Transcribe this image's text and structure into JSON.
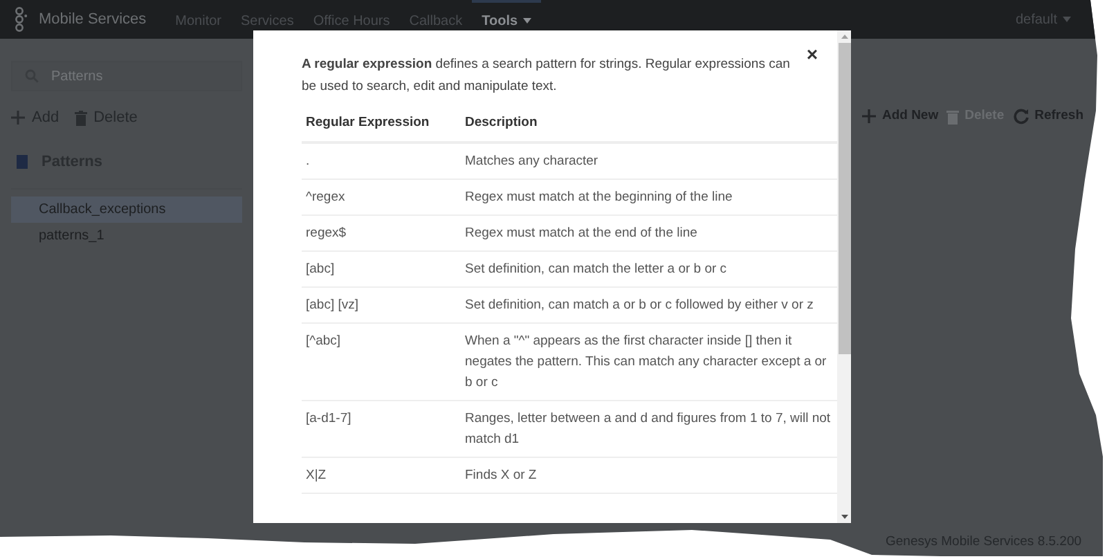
{
  "app": {
    "title": "Mobile Services",
    "menu": [
      {
        "label": "Monitor",
        "selected": false
      },
      {
        "label": "Services",
        "selected": false
      },
      {
        "label": "Office Hours",
        "selected": false
      },
      {
        "label": "Callback",
        "selected": false
      },
      {
        "label": "Tools",
        "selected": true,
        "dropdown": true
      }
    ],
    "user_menu": "default"
  },
  "sidebar": {
    "search": {
      "placeholder": "Patterns"
    },
    "actions": [
      "Add",
      "Delete"
    ],
    "section": "Patterns",
    "items": [
      {
        "label": "Callback_exceptions",
        "selected": true
      },
      {
        "label": "patterns_1",
        "selected": false
      }
    ]
  },
  "toolbar": [
    {
      "kind": "add",
      "label": "Add New",
      "disabled": false
    },
    {
      "kind": "delete",
      "label": "Delete",
      "disabled": true
    },
    {
      "kind": "refresh",
      "label": "Refresh",
      "disabled": false
    }
  ],
  "footer": "Genesys Mobile Services 8.5.200",
  "dialog": {
    "close": "×",
    "intro": "**A regular expression** defines a search pattern for strings. Regular expressions can be used to search, edit and manipulate text.",
    "columns": [
      "Regular Expression",
      "Description"
    ],
    "rows": [
      {
        "expression": ".",
        "description": "Matches any character"
      },
      {
        "expression": "^regex",
        "description": "Regex must match at the beginning of the line"
      },
      {
        "expression": "regex$",
        "description": "Regex must match at the end of the line"
      },
      {
        "expression": "[abc]",
        "description": "Set definition, can match the letter a or b or c"
      },
      {
        "expression": "[abc] [vz]",
        "description": "Set definition, can match a or b or c followed by either v or z"
      },
      {
        "expression": "[^abc]",
        "description": "When a \"^\" appears as the first character inside [] then it negates the pattern. This can match any character except a or b or c"
      },
      {
        "expression": "[a-d1-7]",
        "description": "Ranges, letter between a and d and figures from 1 to 7, will not match d1"
      },
      {
        "expression": "X|Z",
        "description": "Finds X or Z"
      }
    ]
  }
}
